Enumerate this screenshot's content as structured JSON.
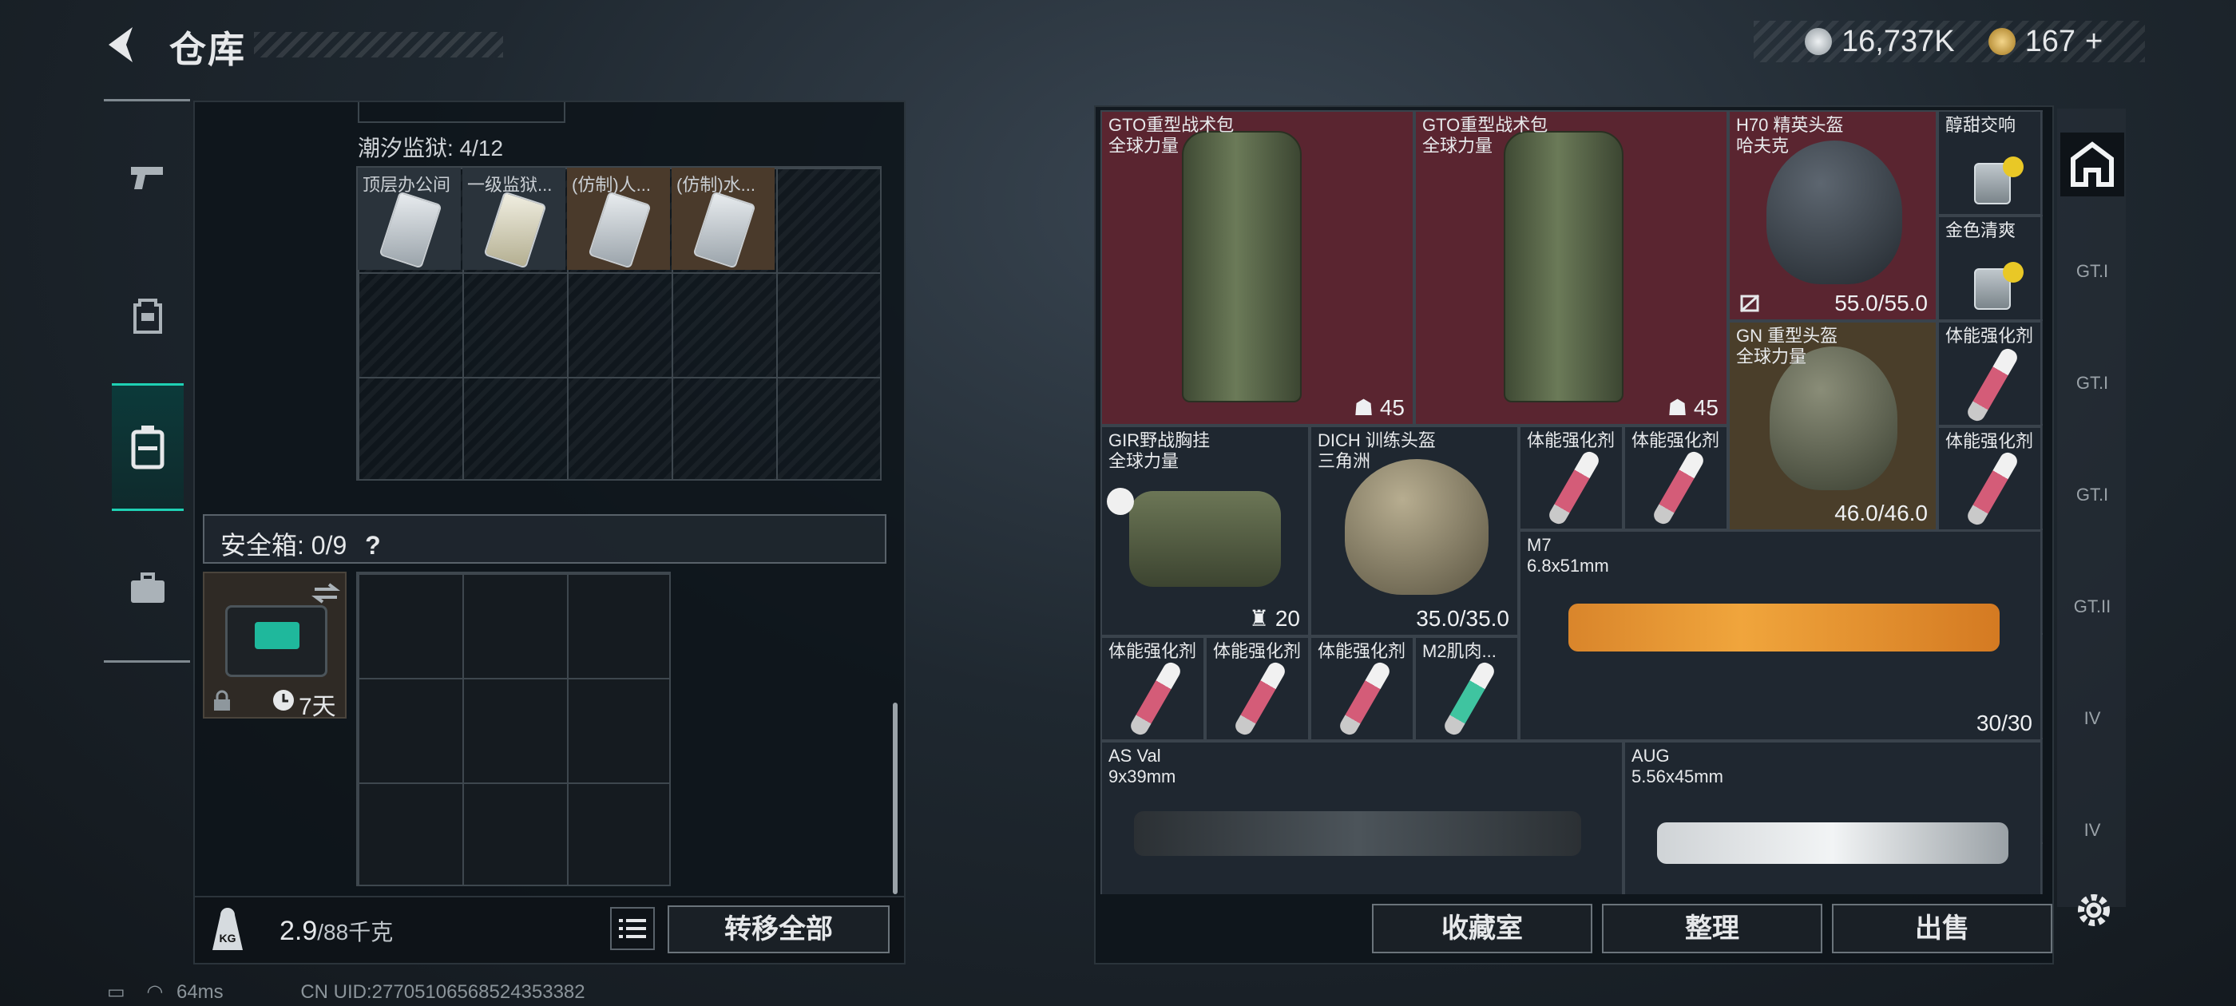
{
  "header": {
    "title": "仓库",
    "currency_a": "16,737K",
    "currency_b": "167",
    "currency_b_plus": "+"
  },
  "left": {
    "prison_label": "潮汐监狱: 4/12",
    "keys": [
      {
        "label": "顶层办公间",
        "tone": "gray"
      },
      {
        "label": "一级监狱...",
        "tone": "gray"
      },
      {
        "label": "(仿制)人...",
        "tone": "brown"
      },
      {
        "label": "(仿制)水...",
        "tone": "brown"
      }
    ],
    "safe_label": "安全箱: 0/9",
    "safe_help": "?",
    "safe_timer": "7天",
    "weight_value": "2.9",
    "weight_unit": "/88千克",
    "transfer_all": "转移全部"
  },
  "items": {
    "gto1": {
      "name": "GTO重型战术包",
      "sub": "全球力量",
      "count": "45"
    },
    "gto2": {
      "name": "GTO重型战术包",
      "sub": "全球力量",
      "count": "45"
    },
    "h70": {
      "name": "H70 精英头盔",
      "sub": "哈夫克",
      "durability": "55.0/55.0"
    },
    "drink1": {
      "name": "醇甜交响"
    },
    "drink2": {
      "name": "金色清爽"
    },
    "gn": {
      "name": "GN 重型头盔",
      "sub": "全球力量",
      "durability": "46.0/46.0"
    },
    "inj_a": {
      "name": "体能强化剂"
    },
    "gir": {
      "name": "GIR野战胸挂",
      "sub": "全球力量",
      "count": "20"
    },
    "dich": {
      "name": "DICH 训练头盔",
      "sub": "三角洲",
      "durability": "35.0/35.0"
    },
    "inj_b": {
      "name": "体能强化剂"
    },
    "inj_c": {
      "name": "体能强化剂"
    },
    "inj_d": {
      "name": "体能强化剂"
    },
    "m7": {
      "name": "M7",
      "sub": "6.8x51mm",
      "ammo": "30/30"
    },
    "inj_e": {
      "name": "体能强化剂"
    },
    "inj_f": {
      "name": "体能强化剂"
    },
    "inj_g": {
      "name": "体能强化剂"
    },
    "m2": {
      "name": "M2肌肉..."
    },
    "asval": {
      "name": "AS Val",
      "sub": "9x39mm"
    },
    "aug": {
      "name": "AUG",
      "sub": "5.56x45mm"
    }
  },
  "buttons": {
    "collection": "收藏室",
    "organize": "整理",
    "sell": "出售"
  },
  "right_rail": [
    "GT.I",
    "GT.I",
    "GT.I",
    "GT.II",
    "IV",
    "IV"
  ],
  "status": {
    "ping": "64ms",
    "uid": "CN UID:27705106568524353382"
  }
}
